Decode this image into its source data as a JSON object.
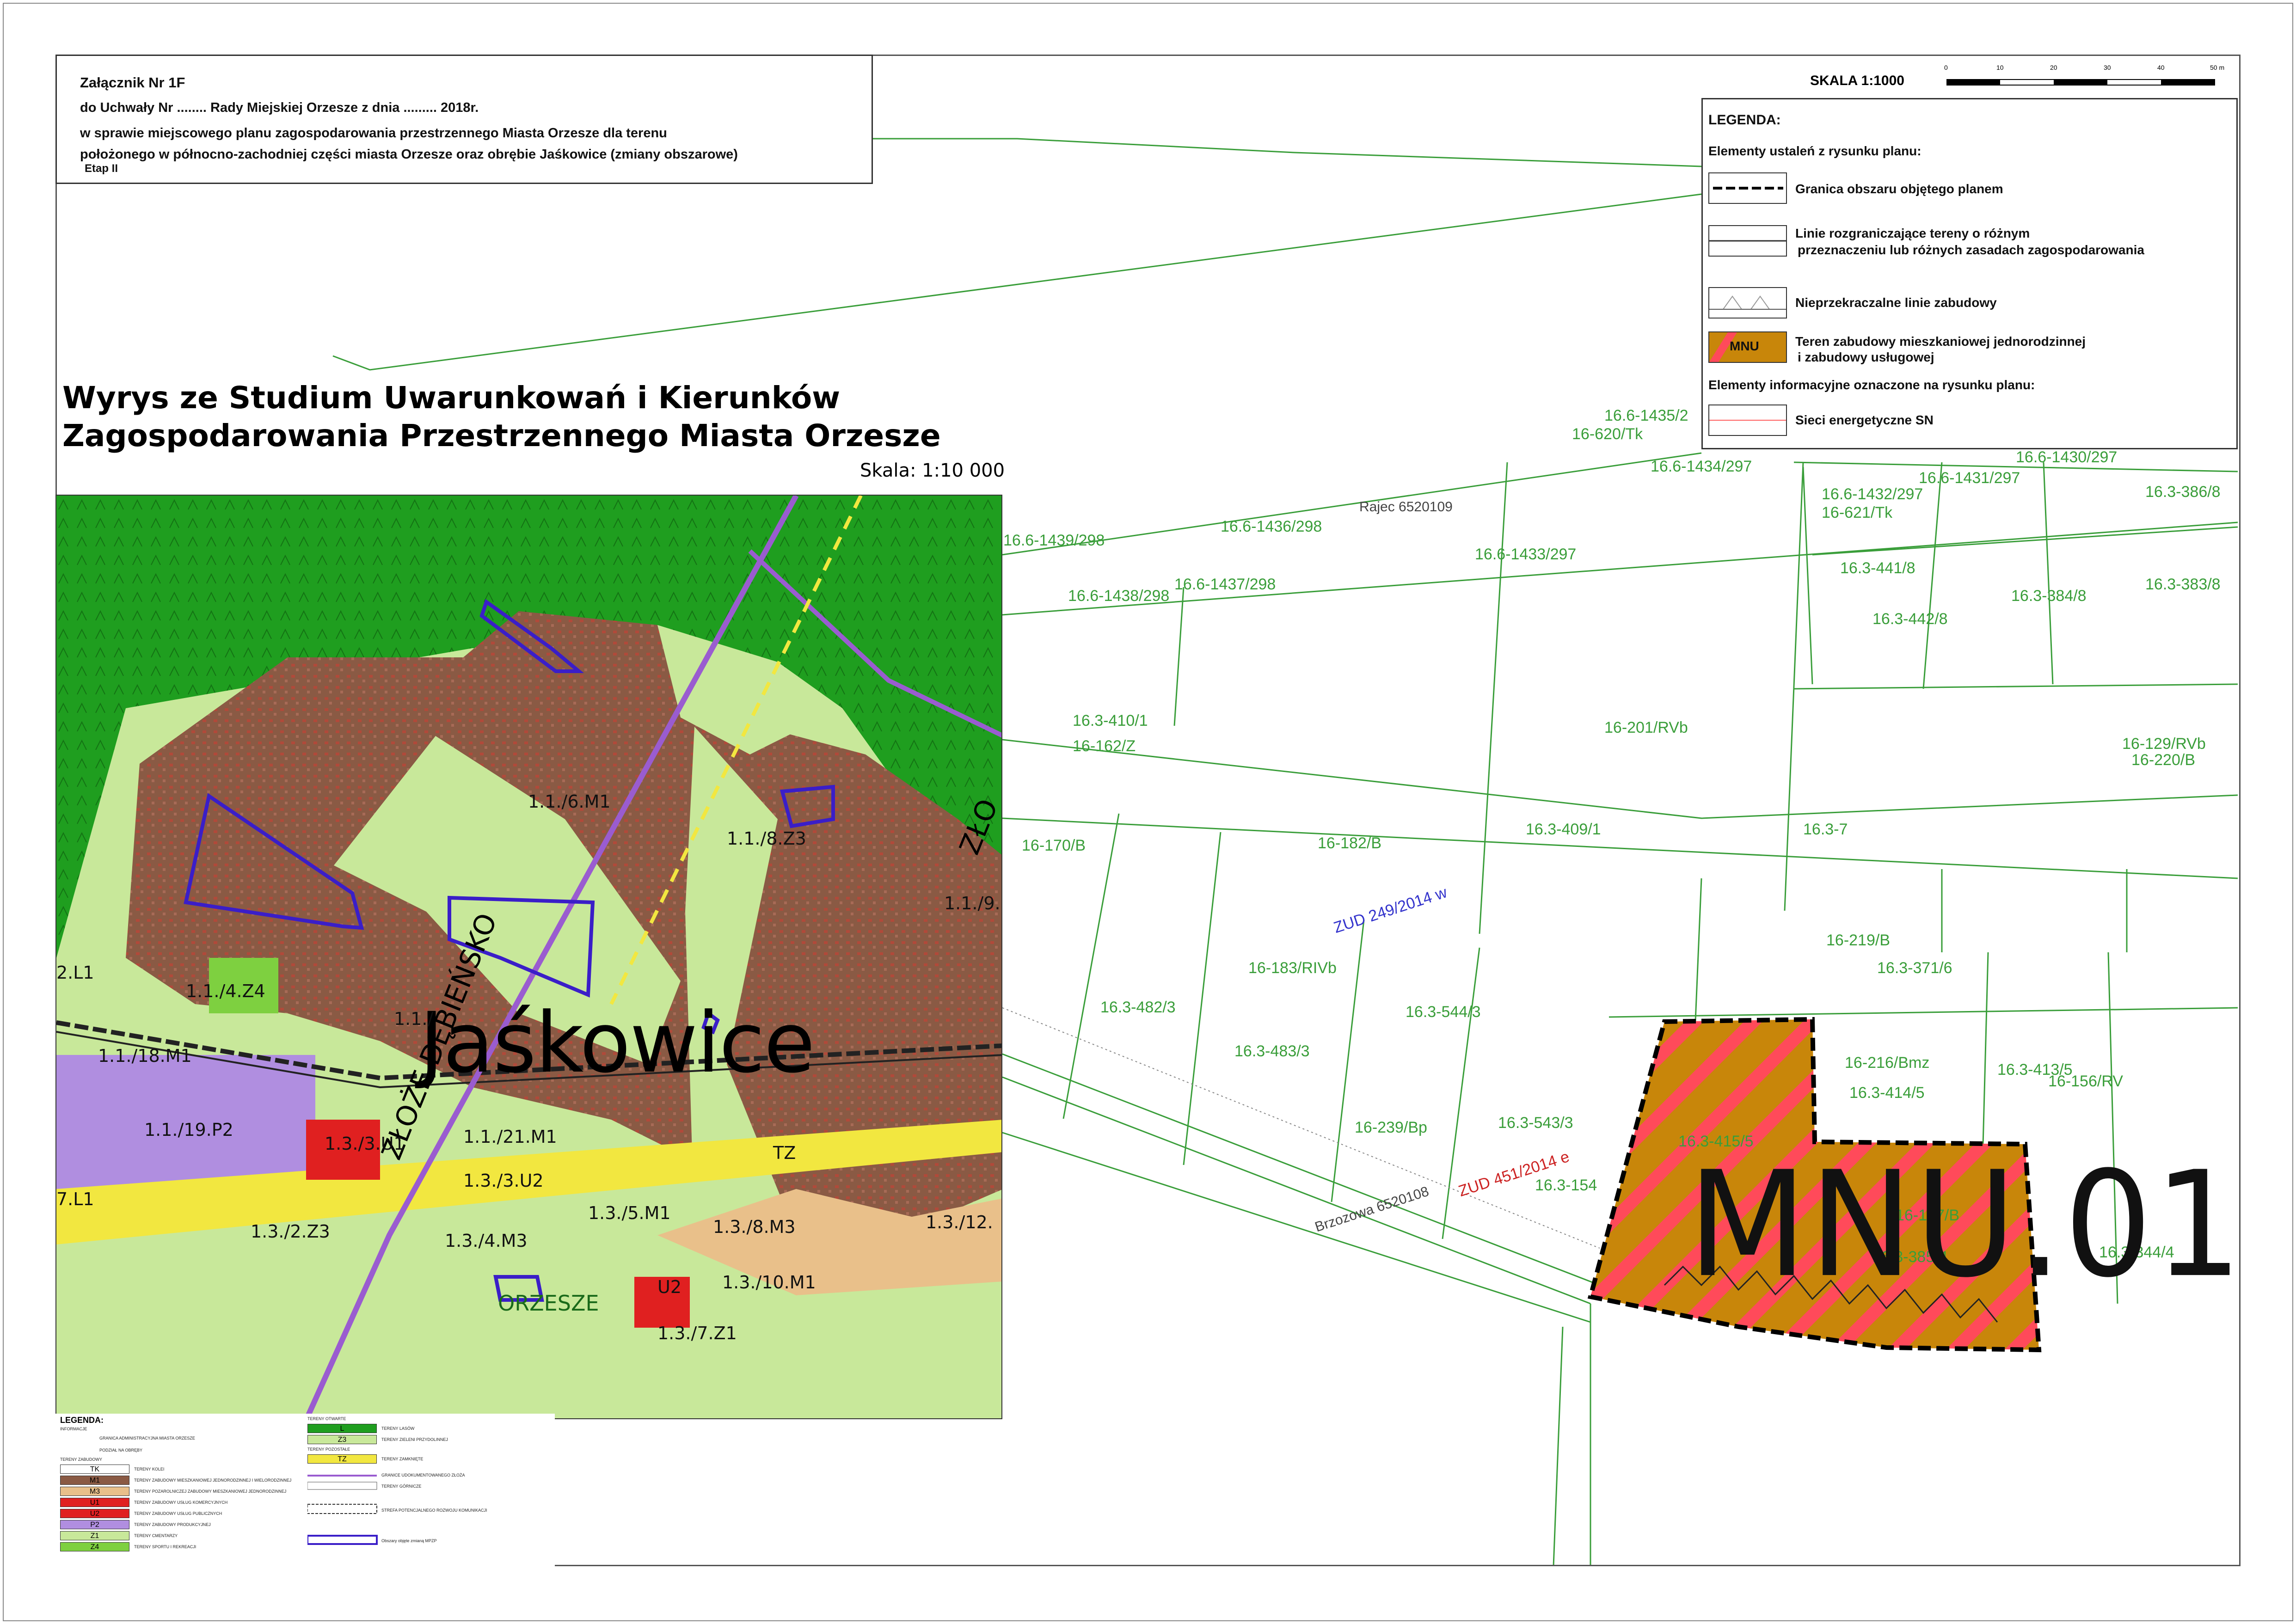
{
  "header": {
    "attachment": "Załącznik Nr 1F",
    "resolution": "do Uchwały Nr ........ Rady Miejskiej Orzesze  z dnia ......... 2018r.",
    "subject_line1": "w sprawie miejscowego planu zagospodarowania  przestrzennego Miasta Orzesze dla terenu",
    "subject_line2": "położonego w północno-zachodniej części miasta Orzesze oraz obrębie Jaśkowice (zmiany obszarowe)",
    "stage": "Etap II"
  },
  "scale": {
    "label": "SKALA 1:1000",
    "ticks": [
      "0",
      "10",
      "20",
      "30",
      "40",
      "50 m"
    ]
  },
  "legend": {
    "title": "LEGENDA:",
    "section1": "Elementy ustaleń z rysunku planu:",
    "boundary": "Granica obszaru objętego planem",
    "lines_1": "Linie rozgraniczające tereny o różnym",
    "lines_2": "przeznaczeniu lub różnych zasadach  zagospodarowania",
    "building_lines": "Nieprzekraczalne linie zabudowy",
    "mnu_symbol": "MNU",
    "mnu_1": "Teren zabudowy mieszkaniowej jednorodzinnej",
    "mnu_2": "i zabudowy usługowej",
    "section2": "Elementy informacyjne oznaczone na rysunku planu:",
    "power": "Sieci energetyczne SN",
    "colors": {
      "mnu": "#c8860a",
      "stripe": "#ff4a5a",
      "parcel": "#3a9e3a"
    }
  },
  "study": {
    "title_line1": "Wyrys ze Studium Uwarunkowań i Kierunków",
    "title_line2": "Zagospodarowania Przestrzennego Miasta Orzesze",
    "scale": "Skala: 1:10 000",
    "place": "Jaśkowice",
    "place2": "ORZESZE",
    "deposit": "ZŁOŻE DĘBIEŃSKO",
    "deposit2": "ZŁO",
    "labels": [
      "1.1./6.M1",
      "1.1./8.Z3",
      "1.1./4.Z4",
      "1.1./18.M1",
      "1.1./19.P2",
      "1.1./21.M1",
      "1.1./9.",
      "1.3./2.Z3",
      "1.3./4.M3",
      "1.3./5.M1",
      "1.3./8.M3",
      "1.3./10.M1",
      "1.3./7.Z1",
      "1.3./12.",
      "1.3./3.U2",
      "U2",
      "TZ",
      "7.L1",
      "2.L1",
      "1.1./",
      "1.3./3.U1"
    ]
  },
  "mini_legend": {
    "title": "LEGENDA:",
    "left_rows": [
      {
        "code": "",
        "text": "INFORMACJE"
      },
      {
        "code": "",
        "text": "GRANICA ADMINISTRACYJNA MIASTA ORZESZE"
      },
      {
        "code": "",
        "text": "PODZIAŁ NA OBRĘBY"
      },
      {
        "code": "",
        "text": "TERENY ZABUDOWY"
      },
      {
        "code": "TK",
        "text": "TERENY KOLEI"
      },
      {
        "code": "M1",
        "text": "TERENY ZABUDOWY MIESZKANIOWEJ JEDNORODZINNEJ I WIELORODZINNEJ"
      },
      {
        "code": "M3",
        "text": "TERENY POZAROLNICZEJ ZABUDOWY MIESZKANIOWEJ JEDNORODZINNEJ"
      },
      {
        "code": "U1",
        "text": "TERENY ZABUDOWY USŁUG KOMERCYJNYCH"
      },
      {
        "code": "U2",
        "text": "TERENY ZABUDOWY USŁUG PUBLICZNYCH"
      },
      {
        "code": "P2",
        "text": "TERENY ZABUDOWY PRODUKCYJNEJ"
      },
      {
        "code": "Z1",
        "text": "TERENY CMENTARZY"
      },
      {
        "code": "Z4",
        "text": "TERENY SPORTU I REKREACJI"
      }
    ],
    "right_rows": [
      {
        "code": "",
        "text": "TERENY OTWARTE"
      },
      {
        "code": "L",
        "text": "TERENY LASÓW"
      },
      {
        "code": "Z3",
        "text": "TERENY ZIELENI PRZYDOLINNEJ"
      },
      {
        "code": "",
        "text": "TERENY POZOSTAŁE"
      },
      {
        "code": "TZ",
        "text": "TERENY ZAMKNIĘTE"
      },
      {
        "code": "",
        "text": "GRANICE UDOKUMENTOWANEGO ZŁOŻA"
      },
      {
        "code": "",
        "text": "TERENY GÓRNICZE"
      },
      {
        "code": "",
        "text": "STREFA POTENCJALNEGO ROZWOJU KOMUNIKACJI"
      },
      {
        "code": "",
        "text": "Obszary objęte zmianą MPZP"
      }
    ]
  },
  "plan": {
    "zone_label": "MNU.01",
    "parcels": [
      "16.6-1435/2",
      "16-620/Tk",
      "16.6-1434/297",
      "16.6-1436/298",
      "Rajec 6520109",
      "16.6-1439/298",
      "16.6-1438/298",
      "16.6-1437/298",
      "16.6-1433/297",
      "16.6-1432/297",
      "16-621/Tk",
      "16.6-1431/297",
      "16.6-1430/297",
      "16.3-386/8",
      "16.3-441/8",
      "16.3-384/8",
      "16.3-383/8",
      "16.3-442/8",
      "16.3-410/1",
      "16-162/Z",
      "16-182/B",
      "16-201/RVb",
      "16.3-409/1",
      "16.3-7",
      "16-129/RVb",
      "16-220/B",
      "16-170/B",
      "16-219/B",
      "16.3-371/6",
      "16-183/RIVb",
      "16.3-482/3",
      "16.3-544/3",
      "16.3-483/3",
      "16-239/Bp",
      "16.3-543/3",
      "16.3-415/5",
      "16.3-414/5",
      "16.3-413/5",
      "16-216/Bmz",
      "16-156/RV",
      "16.3-154",
      "16.3-344/4",
      "ZUD 249/2014 w",
      "ZUD 451/2014 e",
      "Brzozowa 6520108",
      "16-127/B",
      "16.3-385/4"
    ]
  }
}
